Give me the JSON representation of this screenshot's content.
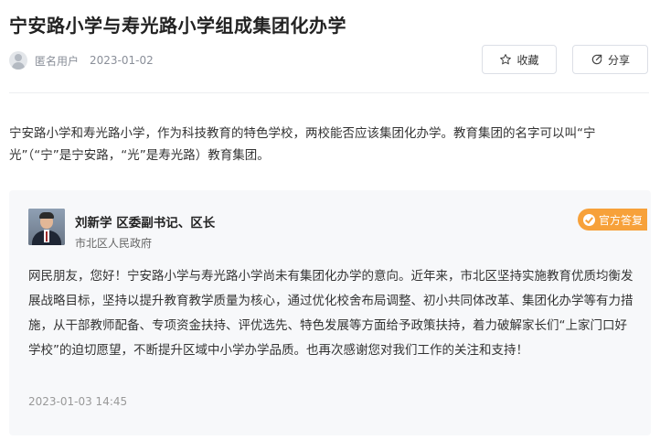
{
  "article": {
    "title": "宁安路小学与寿光路小学组成集团化办学",
    "author": "匿名用户",
    "date": "2023-01-02"
  },
  "actions": {
    "favorite_label": "收藏",
    "share_label": "分享"
  },
  "question": {
    "text": "宁安路小学和寿光路小学，作为科技教育的特色学校，两校能否应该集团化办学。教育集团的名字可以叫“宁光”（“宁”是宁安路，“光”是寿光路）教育集团。"
  },
  "answer": {
    "responder_name": "刘新学  区委副书记、区长",
    "organization": "市北区人民政府",
    "badge_label": "官方答复",
    "content": "网民朋友，您好！宁安路小学与寿光路小学尚未有集团化办学的意向。近年来，市北区坚持实施教育优质均衡发展战略目标，坚持以提升教育教学质量为核心，通过优化校舍布局调整、初小共同体改革、集团化办学等有力措施，从干部教师配备、专项资金扶持、评优选先、特色发展等方面给予政策扶持，着力破解家长们“上家门口好学校”的迫切愿望，不断提升区域中小学办学品质。也再次感谢您对我们工作的关注和支持！",
    "date": "2023-01-03 14:45"
  },
  "icons": {
    "user": "user-avatar-icon",
    "favorite": "star-icon",
    "share": "share-icon",
    "badge": "check-circle-icon"
  },
  "colors": {
    "badge": "#f7a13a",
    "card_bg": "#f7f8fa",
    "meta_text": "#8a8f99"
  }
}
